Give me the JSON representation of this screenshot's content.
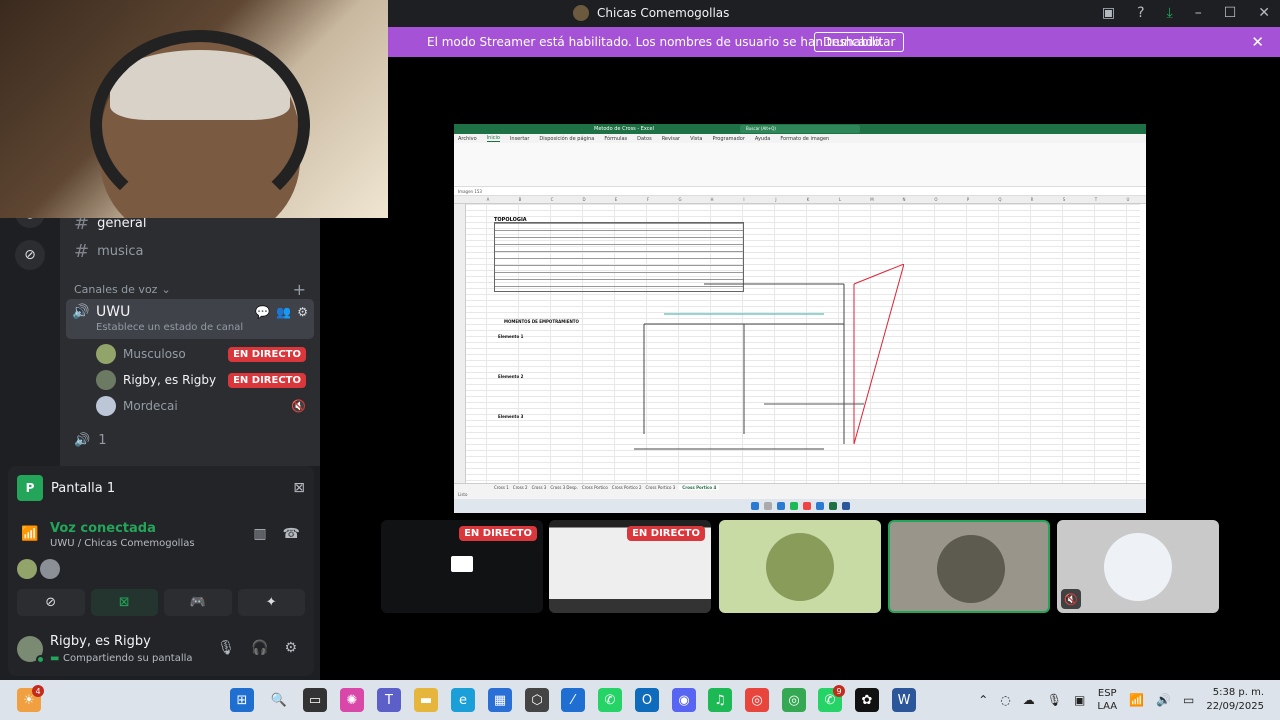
{
  "window": {
    "title": "Chicas Comemogollas"
  },
  "banner": {
    "text": "El modo Streamer está habilitado. Los nombres de usuario se han truncado.",
    "button": "Deshabilitar"
  },
  "channels": {
    "text": [
      {
        "label": "general"
      },
      {
        "label": "musica"
      }
    ],
    "voice_category": "Canales de voz",
    "voice_channel": {
      "name": "UWU",
      "status": "Establece un estado de canal"
    },
    "voice_users": [
      {
        "name": "Musculoso",
        "badge": "EN DIRECTO"
      },
      {
        "name": "Rigby, es Rigby",
        "badge": "EN DIRECTO"
      },
      {
        "name": "Mordecai",
        "badge": ""
      }
    ],
    "second_voice": "1"
  },
  "stream_panel": {
    "logo": "P",
    "title": "Pantalla 1",
    "voice_status": "Voz conectada",
    "voice_location": "UWU / Chicas Comemogollas"
  },
  "user": {
    "name": "Rigby, es Rigby",
    "status": "Compartiendo su pantalla"
  },
  "excel": {
    "title": "Metodo de Cross - Excel",
    "search": "Buscar (Alt+Q)",
    "menu": [
      "Archivo",
      "Inicio",
      "Insertar",
      "Disposición de página",
      "Fórmulas",
      "Datos",
      "Revisar",
      "Vista",
      "Programador",
      "Ayuda",
      "Formato de imagen"
    ],
    "namebox": "Imagen 153",
    "columns": [
      "A",
      "B",
      "C",
      "D",
      "E",
      "F",
      "G",
      "H",
      "I",
      "J",
      "K",
      "L",
      "M",
      "N",
      "O",
      "P",
      "Q",
      "R",
      "S",
      "T",
      "U"
    ],
    "section1": "TOPOLOGIA",
    "section2": "MOMENTOS DE EMPOTRAMIENTO",
    "elements": [
      "Elemento 1",
      "Elemento 2",
      "Elemento 3"
    ],
    "sheets": [
      "Cross 1",
      "Cross 2",
      "Cross 3",
      "Cross 3 Desp.",
      "Cross Portico",
      "Cross Portico 2",
      "Cross Portico 3",
      "Cross Portico 4"
    ],
    "status": "Listo"
  },
  "tiles": {
    "live_label": "EN DIRECTO"
  },
  "taskbar": {
    "weather_badge": "4",
    "lang_top": "ESP",
    "lang_bottom": "LAA",
    "time": "5:38 p. m.",
    "date": "22/09/2025",
    "whatsapp_badge": "9"
  },
  "colors": {
    "banner": "#a652d6",
    "live": "#da373c",
    "voice_green": "#23a55a",
    "excel_green": "#1e7145"
  }
}
